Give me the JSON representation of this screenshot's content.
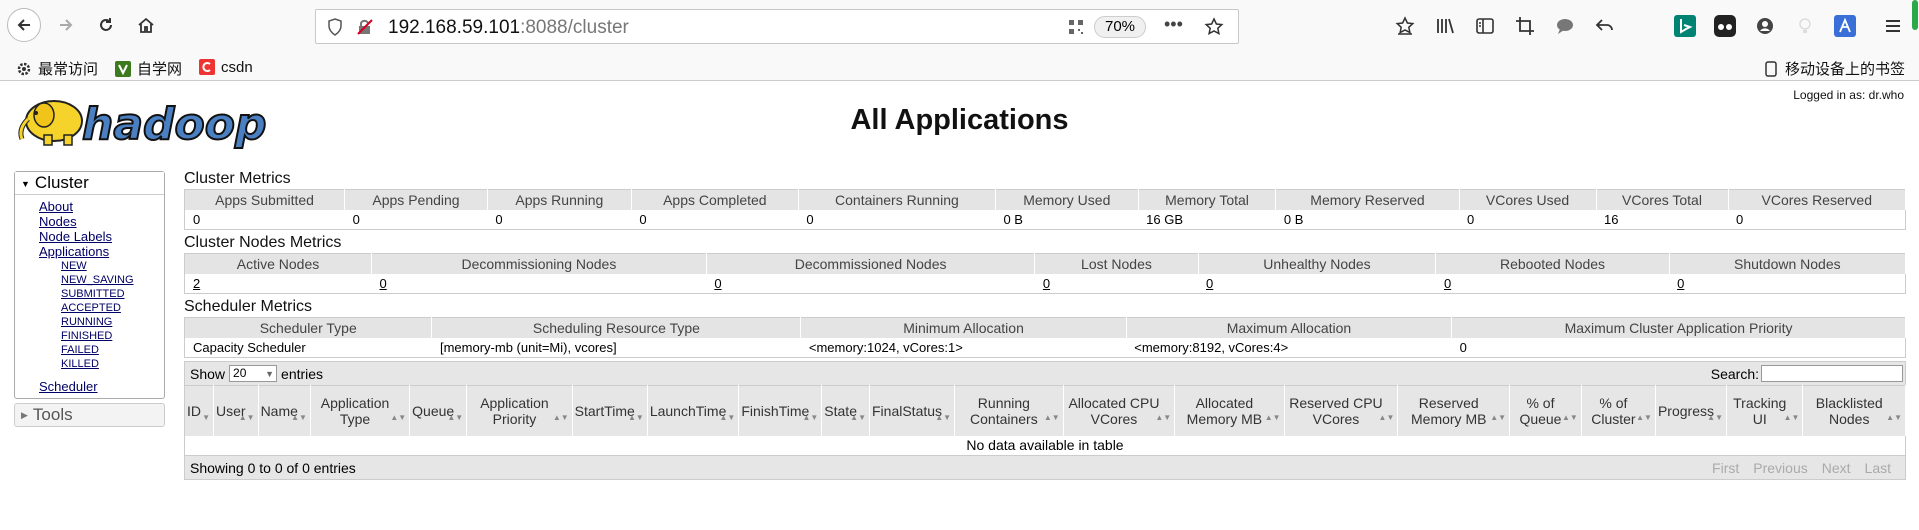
{
  "browser": {
    "url_host": "192.168.59.101",
    "url_rest": ":8088/cluster",
    "zoom": "70%",
    "bookmarks": [
      {
        "label": "最常访问"
      },
      {
        "label": "自学网"
      },
      {
        "label": "csdn"
      }
    ],
    "mobile_bookmarks": "移动设备上的书签"
  },
  "header": {
    "logged_in": "Logged in as: dr.who",
    "title": "All Applications",
    "logo_text": "hadoop"
  },
  "sidebar": {
    "cluster_label": "Cluster",
    "links": [
      "About",
      "Nodes",
      "Node Labels",
      "Applications"
    ],
    "app_states": [
      "NEW",
      "NEW_SAVING",
      "SUBMITTED",
      "ACCEPTED",
      "RUNNING",
      "FINISHED",
      "FAILED",
      "KILLED"
    ],
    "scheduler": "Scheduler",
    "tools_label": "Tools"
  },
  "cluster_metrics": {
    "title": "Cluster Metrics",
    "headers": [
      "Apps Submitted",
      "Apps Pending",
      "Apps Running",
      "Apps Completed",
      "Containers Running",
      "Memory Used",
      "Memory Total",
      "Memory Reserved",
      "VCores Used",
      "VCores Total",
      "VCores Reserved"
    ],
    "values": [
      "0",
      "0",
      "0",
      "0",
      "0",
      "0 B",
      "16 GB",
      "0 B",
      "0",
      "16",
      "0"
    ]
  },
  "node_metrics": {
    "title": "Cluster Nodes Metrics",
    "headers": [
      "Active Nodes",
      "Decommissioning Nodes",
      "Decommissioned Nodes",
      "Lost Nodes",
      "Unhealthy Nodes",
      "Rebooted Nodes",
      "Shutdown Nodes"
    ],
    "values": [
      "2",
      "0",
      "0",
      "0",
      "0",
      "0",
      "0"
    ]
  },
  "scheduler_metrics": {
    "title": "Scheduler Metrics",
    "headers": [
      "Scheduler Type",
      "Scheduling Resource Type",
      "Minimum Allocation",
      "Maximum Allocation",
      "Maximum Cluster Application Priority"
    ],
    "values": [
      "Capacity Scheduler",
      "[memory-mb (unit=Mi), vcores]",
      "<memory:1024, vCores:1>",
      "<memory:8192, vCores:4>",
      "0"
    ]
  },
  "apps_table": {
    "show_label": "Show",
    "entries_value": "20",
    "entries_label": "entries",
    "search_label": "Search:",
    "columns": [
      "ID",
      "User",
      "Name",
      "Application Type",
      "Queue",
      "Application Priority",
      "StartTime",
      "LaunchTime",
      "FinishTime",
      "State",
      "FinalStatus",
      "Running Containers",
      "Allocated CPU VCores",
      "Allocated Memory MB",
      "Reserved CPU VCores",
      "Reserved Memory MB",
      "% of Queue",
      "% of Cluster",
      "Progress",
      "Tracking UI",
      "Blacklisted Nodes"
    ],
    "empty_message": "No data available in table",
    "info": "Showing 0 to 0 of 0 entries",
    "pager": [
      "First",
      "Previous",
      "Next",
      "Last"
    ]
  }
}
